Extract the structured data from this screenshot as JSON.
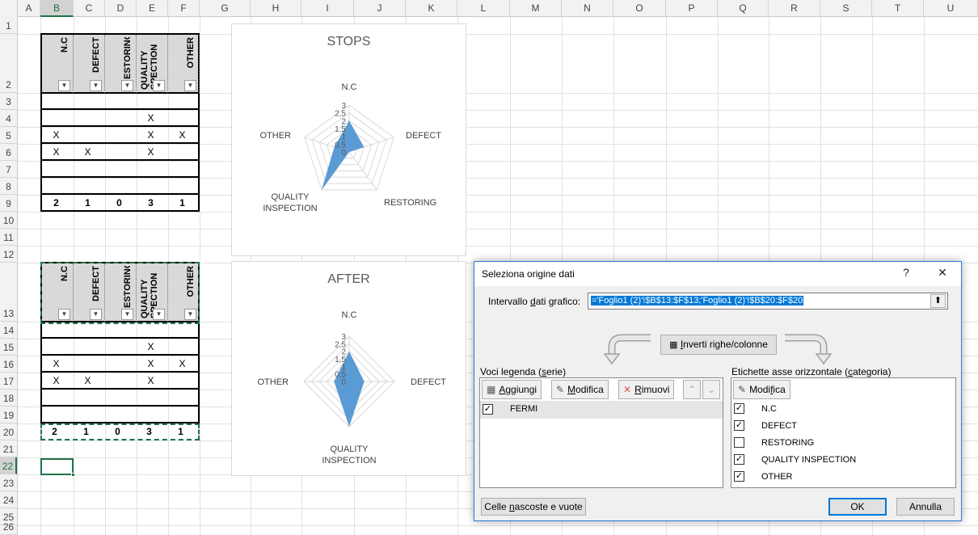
{
  "columns": [
    "A",
    "B",
    "C",
    "D",
    "E",
    "F",
    "G",
    "H",
    "I",
    "J",
    "K",
    "L",
    "M",
    "N",
    "O",
    "P",
    "Q",
    "R",
    "S",
    "T",
    "U"
  ],
  "rows": [
    "1",
    "2",
    "3",
    "4",
    "5",
    "6",
    "7",
    "8",
    "9",
    "10",
    "11",
    "12",
    "13",
    "14",
    "15",
    "16",
    "17",
    "18",
    "19",
    "20",
    "21",
    "22",
    "23",
    "24",
    "25",
    "26"
  ],
  "table_headers": [
    "N.C",
    "DEFECT",
    "ESTORING",
    "QUALITY SPECTION",
    "OTHER"
  ],
  "table1": {
    "rows": [
      [
        "",
        "",
        "",
        "",
        ""
      ],
      [
        "",
        "",
        "",
        "X",
        ""
      ],
      [
        "X",
        "",
        "",
        "X",
        "X"
      ],
      [
        "X",
        "X",
        "",
        "X",
        ""
      ],
      [
        "",
        "",
        "",
        "",
        ""
      ],
      [
        "",
        "",
        "",
        "",
        ""
      ]
    ],
    "totals": [
      "2",
      "1",
      "0",
      "3",
      "1"
    ]
  },
  "table2": {
    "rows": [
      [
        "",
        "",
        "",
        "",
        ""
      ],
      [
        "",
        "",
        "",
        "X",
        ""
      ],
      [
        "X",
        "",
        "",
        "X",
        "X"
      ],
      [
        "X",
        "X",
        "",
        "X",
        ""
      ],
      [
        "",
        "",
        "",
        "",
        ""
      ],
      [
        "",
        "",
        "",
        "",
        ""
      ]
    ],
    "totals": [
      "2",
      "1",
      "0",
      "3",
      "1"
    ]
  },
  "chart_data": [
    {
      "type": "radar",
      "title": "STOPS",
      "categories": [
        "N.C",
        "DEFECT",
        "RESTORING",
        "QUALITY INSPECTION",
        "OTHER"
      ],
      "values": [
        2,
        1,
        0,
        3,
        1
      ],
      "axis_ticks": [
        "0",
        "0,5",
        "1",
        "1,5",
        "2",
        "2,5",
        "3"
      ],
      "ylim": [
        0,
        3
      ],
      "color": "#5b9bd5"
    },
    {
      "type": "radar",
      "title": "AFTER",
      "categories": [
        "N.C",
        "DEFECT",
        "QUALITY INSPECTION",
        "OTHER"
      ],
      "values": [
        2,
        1,
        3,
        1
      ],
      "axis_ticks": [
        "0",
        "0,5",
        "1",
        "1,5",
        "2",
        "2,5",
        "3"
      ],
      "ylim": [
        0,
        3
      ],
      "color": "#5b9bd5"
    }
  ],
  "dialog": {
    "title": "Seleziona origine dati",
    "help": "?",
    "close": "✕",
    "range_label": "Intervallo dati grafico:",
    "range_value": "='Foglio1 (2)'!$B$13:$F$13;'Foglio1 (2)'!$B$20:$F$20",
    "switch_button": "Inverti righe/colonne",
    "legend_label": "Voci legenda (serie)",
    "add_button": "Aggiungi",
    "edit_button": "Modifica",
    "remove_button": "Rimuovi",
    "series": [
      {
        "name": "FERMI",
        "checked": true
      }
    ],
    "axis_label": "Etichette asse orizzontale (categoria)",
    "axis_edit_button": "Modifica",
    "categories": [
      {
        "name": "N.C",
        "checked": true
      },
      {
        "name": "DEFECT",
        "checked": true
      },
      {
        "name": "RESTORING",
        "checked": false
      },
      {
        "name": "QUALITY INSPECTION",
        "checked": true
      },
      {
        "name": "OTHER",
        "checked": true
      }
    ],
    "hidden_cells_button": "Celle nascoste e vuote",
    "ok_button": "OK",
    "cancel_button": "Annulla"
  }
}
